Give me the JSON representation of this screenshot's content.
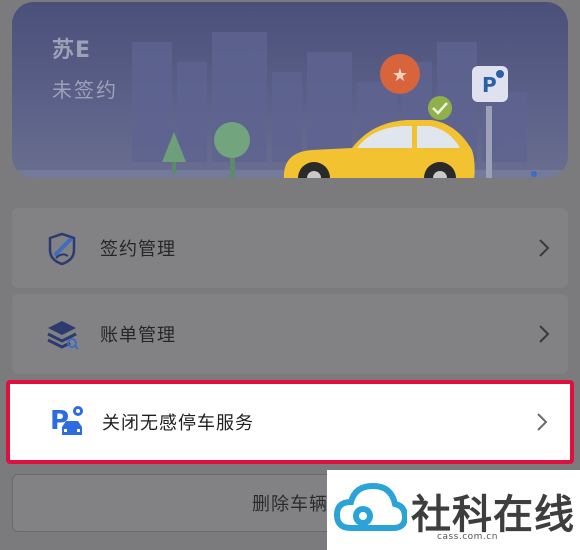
{
  "vehicle": {
    "plate": "苏E",
    "sign_status": "未签约"
  },
  "menu": {
    "items": [
      {
        "label": "签约管理",
        "icon": "sign-contract-icon"
      },
      {
        "label": "账单管理",
        "icon": "bill-stack-icon"
      },
      {
        "label": "关闭无感停车服务",
        "icon": "parking-car-icon"
      }
    ]
  },
  "actions": {
    "delete_vehicle": "删除车辆"
  },
  "watermark": {
    "text": "社科在线",
    "domain": "cass.com.cn"
  },
  "colors": {
    "highlight_border": "#e0103e",
    "car": "#f2c230",
    "hero_bg": "#4a5079",
    "icon_blue": "#2d6cdf"
  }
}
